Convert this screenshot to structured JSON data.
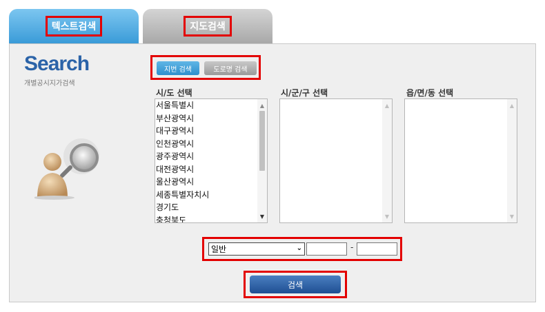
{
  "tabs": [
    {
      "label": "텍스트검색",
      "active": true
    },
    {
      "label": "지도검색",
      "active": false
    }
  ],
  "brand": {
    "logo": "Search",
    "subtitle": "개별공시지가검색"
  },
  "search_type": {
    "lot_number": "지번 검색",
    "road_name": "도로명 검색"
  },
  "columns": {
    "province": "시/도 선택",
    "city": "시/군/구 선택",
    "town": "읍/면/동 선택"
  },
  "provinces": [
    "서울특별시",
    "부산광역시",
    "대구광역시",
    "인천광역시",
    "광주광역시",
    "대전광역시",
    "울산광역시",
    "세종특별자치시",
    "경기도",
    "충청북도"
  ],
  "filter": {
    "land_type": "일반",
    "main_number": "",
    "sub_number": "",
    "separator": "-"
  },
  "search_button": "검색",
  "colors": {
    "tab_active": "#3a9bd8",
    "highlight": "#e30000",
    "brand_blue": "#2b63a8",
    "button_blue": "#1f4f93"
  }
}
